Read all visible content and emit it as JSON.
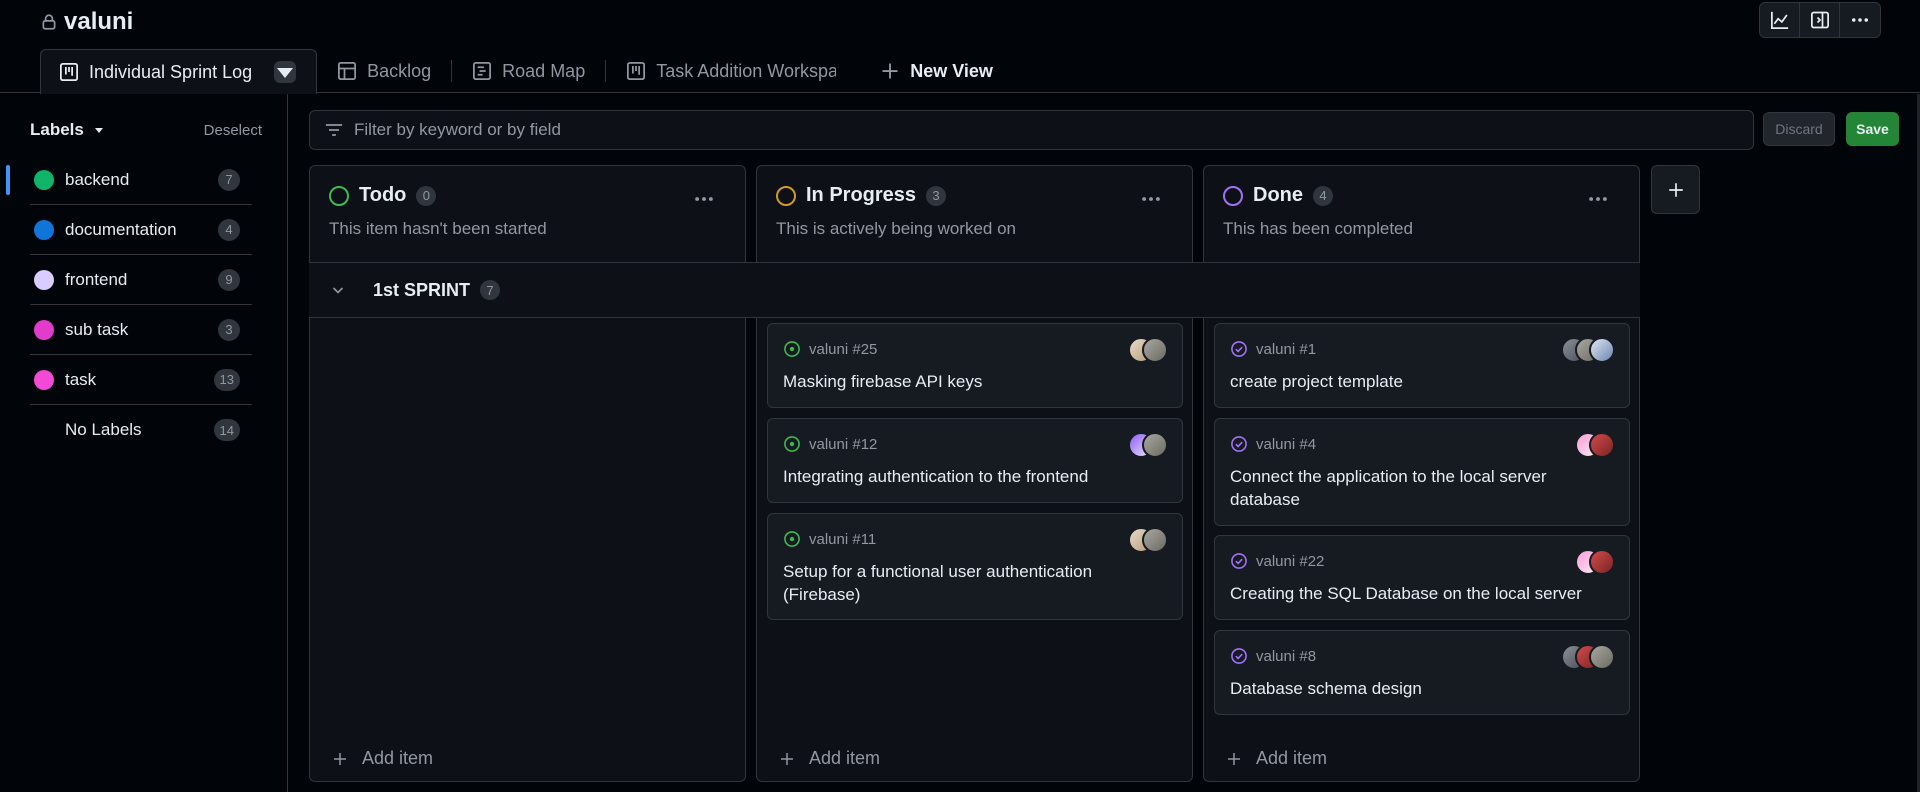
{
  "project": {
    "title": "valuni"
  },
  "tabs": [
    {
      "label": "Individual Sprint Log",
      "active": true
    },
    {
      "label": "Backlog"
    },
    {
      "label": "Road Map"
    },
    {
      "label": "Task Addition Workspac"
    },
    {
      "label": "New View"
    }
  ],
  "sidebar": {
    "heading": "Labels",
    "deselect": "Deselect",
    "items": [
      {
        "label": "backend",
        "count": "7",
        "color": "#10b56a"
      },
      {
        "label": "documentation",
        "count": "4",
        "color": "#0f75d9"
      },
      {
        "label": "frontend",
        "count": "9",
        "color": "#d8cdfc"
      },
      {
        "label": "sub task",
        "count": "3",
        "color": "#e33ccc"
      },
      {
        "label": "task",
        "count": "13",
        "color": "#f24ad4"
      },
      {
        "label": "No Labels",
        "count": "14"
      }
    ]
  },
  "filter": {
    "placeholder": "Filter by keyword or by field"
  },
  "actions": {
    "discard": "Discard",
    "save": "Save"
  },
  "columns": [
    {
      "name": "Todo",
      "count": "0",
      "description": "This item hasn't been started",
      "color": "#3fb950",
      "add": "Add item"
    },
    {
      "name": "In Progress",
      "count": "3",
      "description": "This is actively being worked on",
      "color": "#d29922",
      "add": "Add item"
    },
    {
      "name": "Done",
      "count": "4",
      "description": "This has been completed",
      "color": "#a371f7",
      "add": "Add item"
    }
  ],
  "sprint": {
    "name": "1st SPRINT",
    "count": "7"
  },
  "cards": {
    "in_progress": [
      {
        "ref": "valuni #25",
        "title": "Masking firebase API keys"
      },
      {
        "ref": "valuni #12",
        "title": "Integrating authentication to the frontend"
      },
      {
        "ref": "valuni #11",
        "title": "Setup for a functional user authentication (Firebase)"
      }
    ],
    "done": [
      {
        "ref": "valuni #1",
        "title": "create project template"
      },
      {
        "ref": "valuni #4",
        "title": "Connect the application to the local server database"
      },
      {
        "ref": "valuni #22",
        "title": "Creating the SQL Database on the local server"
      },
      {
        "ref": "valuni #8",
        "title": "Database schema design"
      }
    ]
  }
}
